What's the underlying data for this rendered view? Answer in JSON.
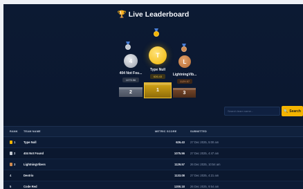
{
  "header": {
    "title": "Live Leaderboard",
    "trophy_icon": "trophy-icon"
  },
  "podium": {
    "second": {
      "initial": "4",
      "name": "404 Not Fou...",
      "score": "1075.56",
      "place": "2",
      "medal_color": "#c5cad3"
    },
    "first": {
      "initial": "T",
      "name": "Type Null",
      "score": "626.43",
      "place": "1",
      "medal_color": "#f4b400"
    },
    "third": {
      "initial": "L",
      "name": "LightningVib...",
      "score": "1129.57",
      "place": "3",
      "medal_color": "#d08a4f"
    }
  },
  "search": {
    "placeholder": "Search team name...",
    "button_label": "Search",
    "icon": "search-icon"
  },
  "table": {
    "headers": {
      "rank": "RANK",
      "team": "TEAM NAME",
      "score": "METRIC SCORE",
      "submitted": "SUBMITTED"
    },
    "rows": [
      {
        "rank": "1",
        "medal": "gold",
        "team": "Type Null",
        "score": "626.43",
        "submitted": "27 Dec 2025, 5:00 am"
      },
      {
        "rank": "2",
        "medal": "silver",
        "team": "404 Not Found",
        "score": "1075.56",
        "submitted": "27 Dec 2025, 4:47 am"
      },
      {
        "rank": "3",
        "medal": "bronze",
        "team": "LightningVibers",
        "score": "1129.57",
        "submitted": "26 Dec 2025, 10:54 am"
      },
      {
        "rank": "4",
        "medal": "",
        "team": "Devtrio",
        "score": "1133.08",
        "submitted": "27 Dec 2025, 4:21 am"
      },
      {
        "rank": "5",
        "medal": "",
        "team": "Code Red",
        "score": "1200.18",
        "submitted": "26 Dec 2025, 9:54 am"
      }
    ]
  },
  "colors": {
    "gold": "#f4b400",
    "silver": "#c5cad3",
    "bronze": "#d08a4f",
    "background": "#0b1830"
  }
}
